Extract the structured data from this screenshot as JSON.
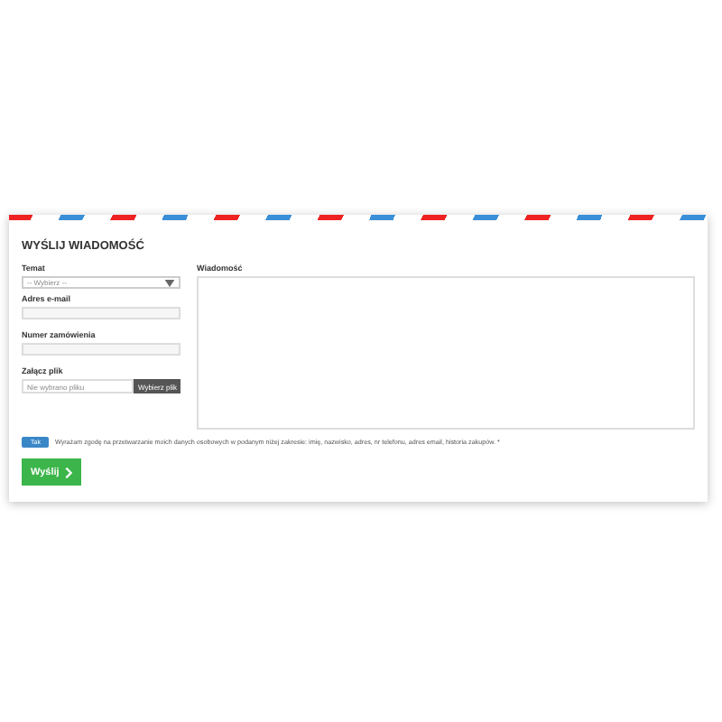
{
  "form": {
    "title": "WYŚLIJ WIADOMOŚĆ",
    "subject": {
      "label": "Temat",
      "value": "-- Wybierz --"
    },
    "email": {
      "label": "Adres e-mail"
    },
    "order": {
      "label": "Numer zamówienia"
    },
    "file": {
      "label": "Załącz plik",
      "status": "Nie wybrano pliku",
      "button": "Wybierz plik"
    },
    "message": {
      "label": "Wiadomość"
    },
    "consent": {
      "toggle_label": "Tak",
      "on": true,
      "text": "Wyrażam zgodę na przetwarzanie moich danych osobowych w podanym niżej zakresie: imię, nazwisko, adres, nr telefonu, adres email, historia zakupów. *"
    },
    "submit": "Wyślij"
  }
}
